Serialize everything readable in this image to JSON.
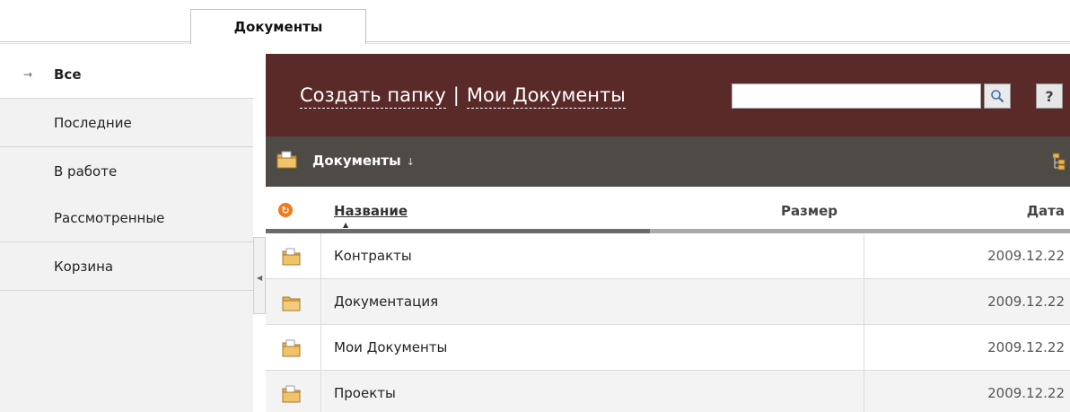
{
  "tabs": {
    "active_label": "Документы"
  },
  "nav": {
    "items": [
      {
        "label": "Все",
        "active": true
      },
      {
        "label": "Последние",
        "active": false
      },
      {
        "label": "В работе",
        "active": false
      },
      {
        "label": "Рассмотренные",
        "active": false
      },
      {
        "label": "Корзина",
        "active": false
      }
    ],
    "active_arrow": "→"
  },
  "header": {
    "create_folder": "Создать папку",
    "separator": "|",
    "my_documents": "Мои Документы",
    "search_value": "",
    "help_label": "?"
  },
  "toolbar": {
    "crumb": "Документы",
    "crumb_drop": "↓"
  },
  "table": {
    "col_name": "Название",
    "col_size": "Размер",
    "col_date": "Дата",
    "rows": [
      {
        "name": "Контракты",
        "size": "",
        "date": "2009.12.22",
        "icon": "folder-documents-icon"
      },
      {
        "name": "Документация",
        "size": "",
        "date": "2009.12.22",
        "icon": "folder-icon"
      },
      {
        "name": "Мои Документы",
        "size": "",
        "date": "2009.12.22",
        "icon": "folder-documents-icon"
      },
      {
        "name": "Проекты",
        "size": "",
        "date": "2009.12.22",
        "icon": "folder-documents-icon"
      }
    ]
  },
  "colors": {
    "header_bg": "#5a2a28",
    "toolbar_bg": "#4e4a46",
    "nav_bg": "#f2f2f2",
    "refresh_orange": "#f07a1a"
  }
}
